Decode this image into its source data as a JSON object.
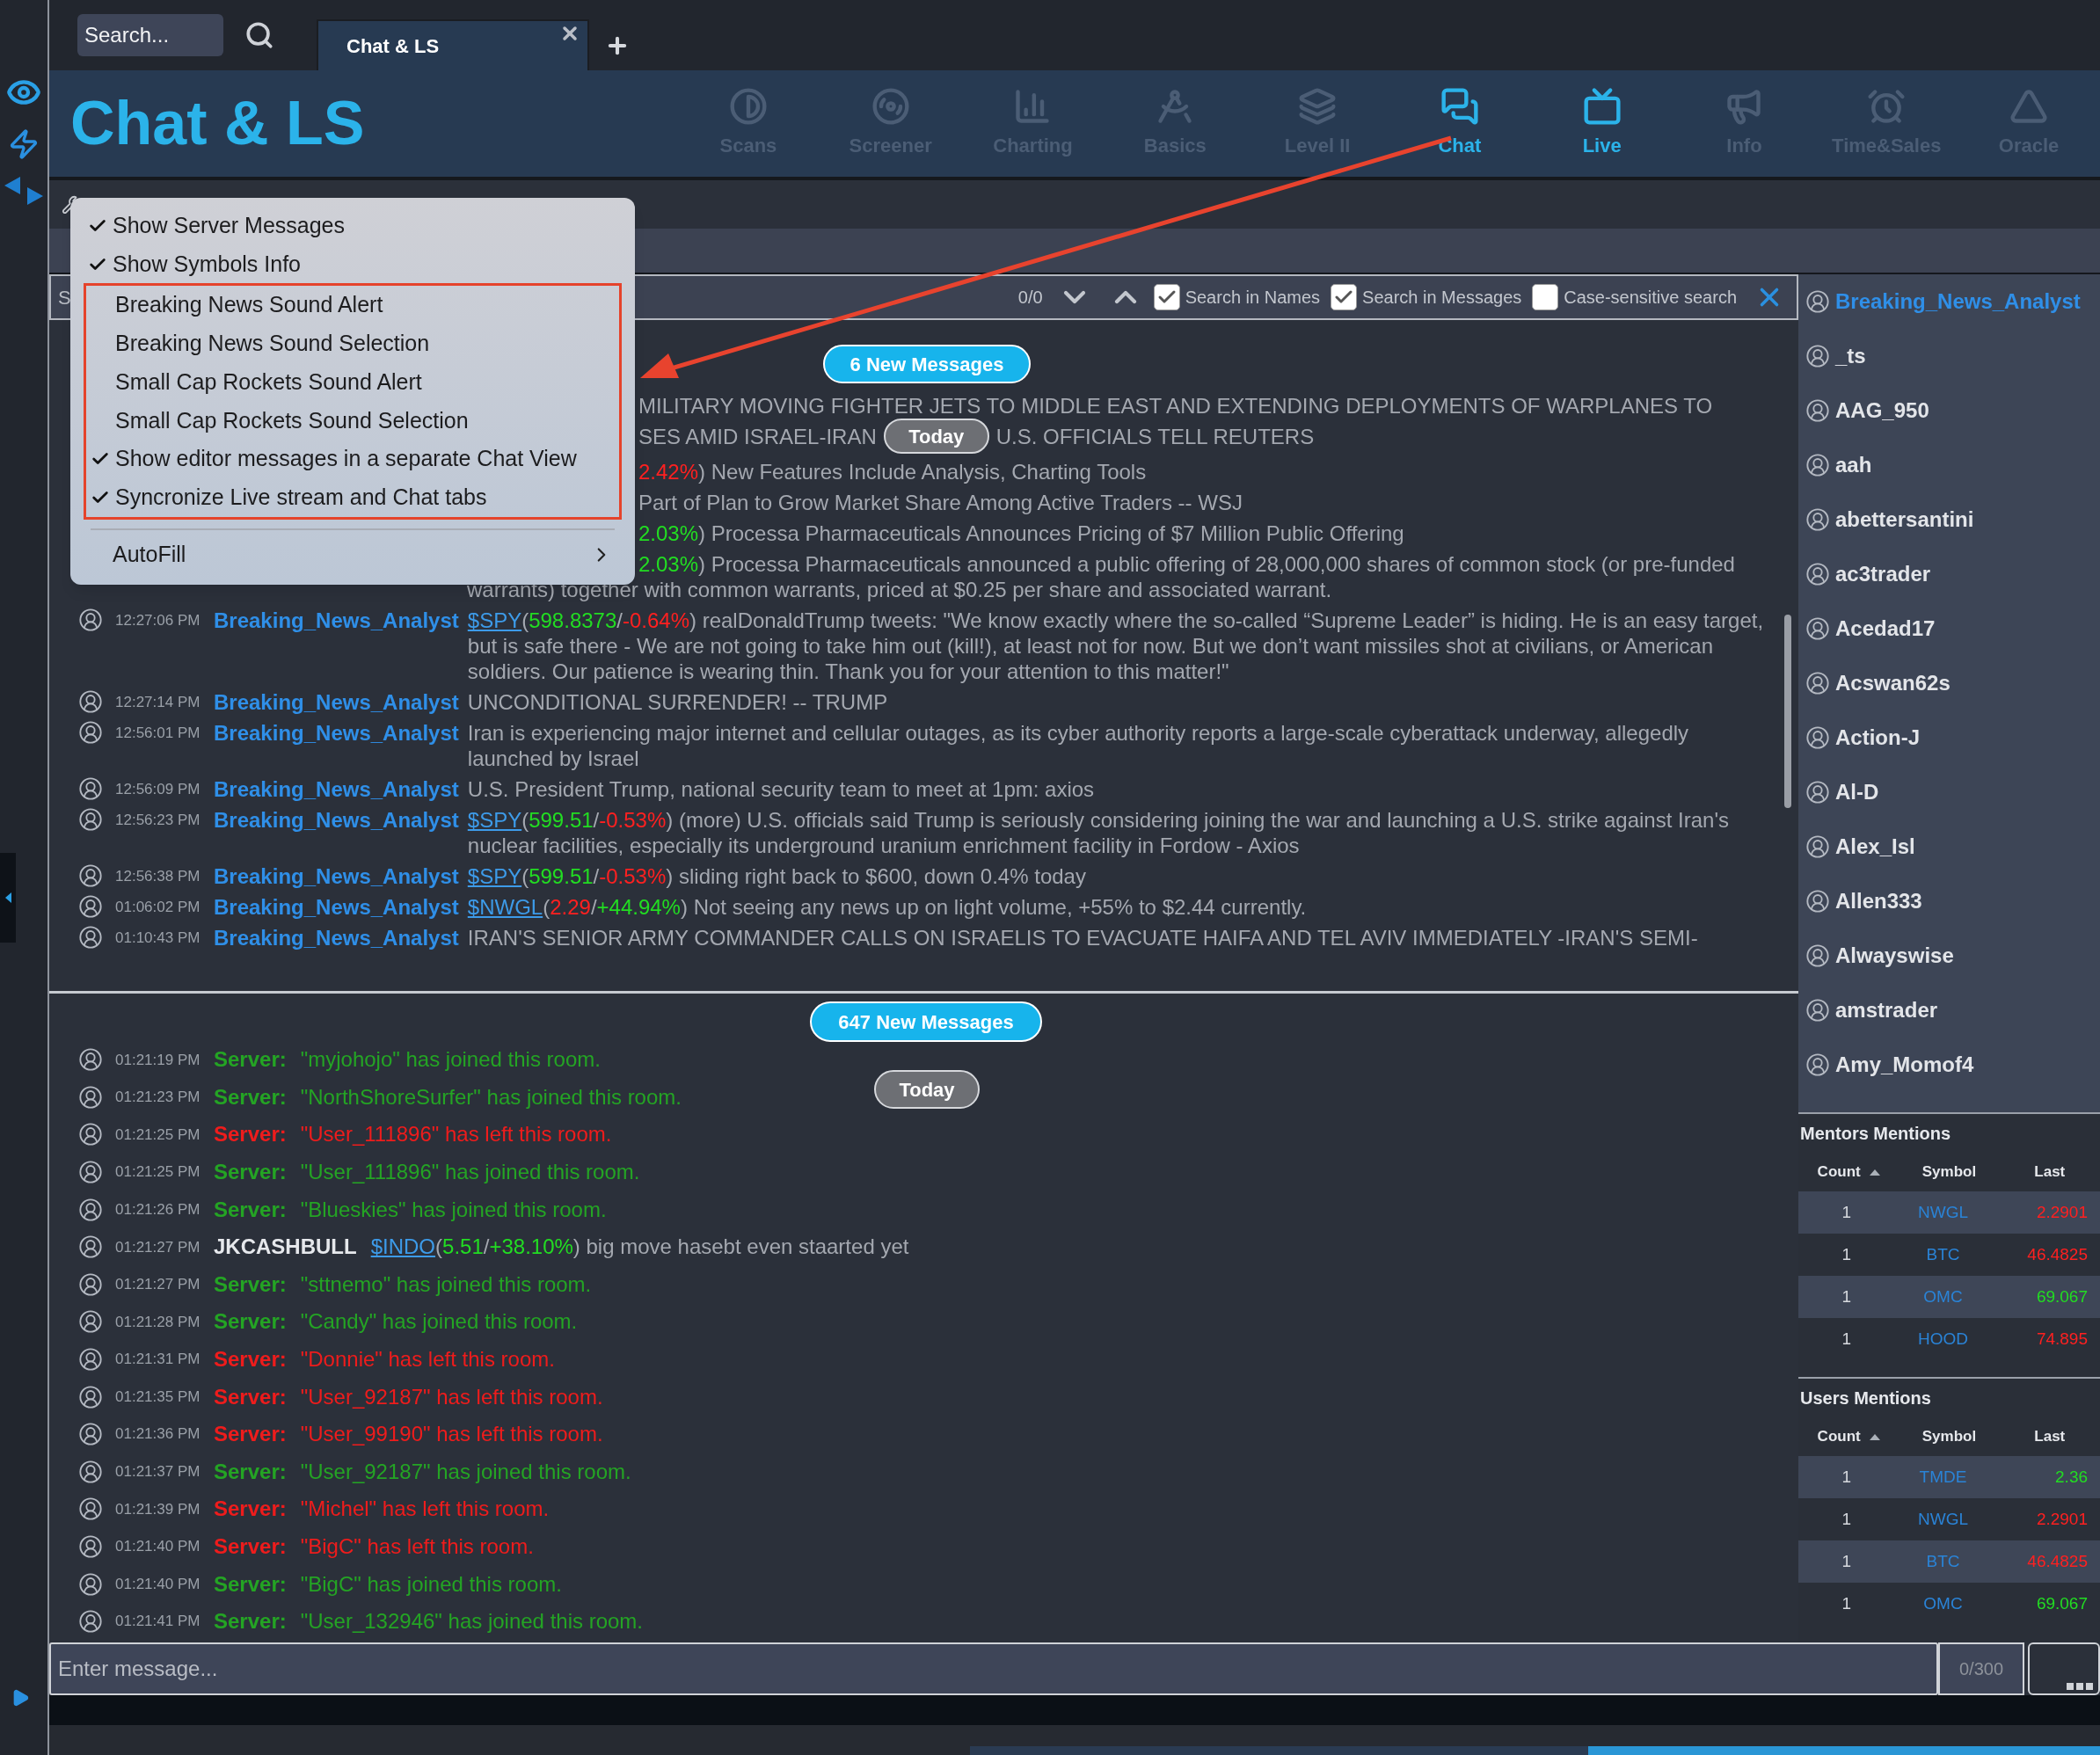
{
  "top_bar": {
    "search_placeholder": "Search...",
    "tabs": [
      {
        "label": "Chat & LS",
        "selected": true
      }
    ]
  },
  "header": {
    "title": "Chat & LS",
    "nav": [
      {
        "label": "Scans",
        "active": false
      },
      {
        "label": "Screener",
        "active": false
      },
      {
        "label": "Charting",
        "active": false
      },
      {
        "label": "Basics",
        "active": false
      },
      {
        "label": "Level II",
        "active": false
      },
      {
        "label": "Chat",
        "active": true
      },
      {
        "label": "Live",
        "active": true
      },
      {
        "label": "Info",
        "active": false
      },
      {
        "label": "Time&Sales",
        "active": false
      },
      {
        "label": "Oracle",
        "active": false
      }
    ]
  },
  "menu": {
    "items": [
      {
        "label": "Show Server Messages",
        "checked": true,
        "highlighted": false
      },
      {
        "label": "Show Symbols Info",
        "checked": true,
        "highlighted": false
      },
      {
        "label": "Breaking News Sound Alert",
        "checked": false,
        "highlighted": true
      },
      {
        "label": "Breaking News Sound Selection",
        "checked": false,
        "highlighted": true
      },
      {
        "label": "Small Cap Rockets Sound Alert",
        "checked": false,
        "highlighted": true
      },
      {
        "label": "Small Cap Rockets Sound Selection",
        "checked": false,
        "highlighted": true
      },
      {
        "label": "Show editor messages in a separate Chat View",
        "checked": true,
        "highlighted": true
      },
      {
        "label": "Syncronize Live stream and Chat tabs",
        "checked": true,
        "highlighted": true
      }
    ],
    "submenu": {
      "label": "AutoFill"
    }
  },
  "search_bar": {
    "placeholder": "S",
    "count": "0/0",
    "options": [
      {
        "label": "Search in Names",
        "checked": true
      },
      {
        "label": "Search in Messages",
        "checked": true
      },
      {
        "label": "Case-sensitive search",
        "checked": false
      }
    ]
  },
  "editor_pane": {
    "new_messages": "6 New Messages",
    "day_label": "Today",
    "messages": [
      {
        "kind": "fragment",
        "text": "MILITARY MOVING FIGHTER JETS TO MIDDLE EAST AND EXTENDING DEPLOYMENTS OF WARPLANES TO",
        "line_2_parts": [
          "SES AMID ISRAEL-IRAN",
          "U.S. OFFICIALS TELL REUTERS"
        ]
      },
      {
        "kind": "fragment",
        "change": "2.42%",
        "change_up": false,
        "text": ") New Features Include Analysis, Charting Tools"
      },
      {
        "kind": "fragment",
        "text": "Part of Plan to Grow Market Share Among Active Traders -- WSJ"
      },
      {
        "kind": "fragment",
        "change": "2.03%",
        "change_up": true,
        "text": ") Processa Pharmaceuticals Announces Pricing of $7 Million Public Offering"
      },
      {
        "kind": "fragment",
        "change": "2.03%",
        "change_up": true,
        "text": ") Processa Pharmaceuticals announced a public offering of 28,000,000 shares of common stock (or pre-funded",
        "continuation": "warrants) together with common warrants, priced at $0.25 per share and associated warrant."
      },
      {
        "kind": "message",
        "time": "12:27:06 PM",
        "user": "Breaking_News_Analyst",
        "quote": {
          "symbol": "$SPY",
          "open": "(",
          "price": "598.8373",
          "price_up": true,
          "separator": "/",
          "change": "-0.64%",
          "change_up": false,
          "close": ")"
        },
        "text": "realDonaldTrump tweets: \"We know exactly where the so-called “Supreme Leader” is hiding. He is an easy target, but is safe there - We are not going to take him out (kill!), at least not for now. But we don’t want missiles shot at civilians, or American soldiers. Our patience is wearing thin. Thank you for your attention to this matter!\""
      },
      {
        "kind": "message",
        "time": "12:27:14 PM",
        "user": "Breaking_News_Analyst",
        "text": "UNCONDITIONAL SURRENDER! -- TRUMP"
      },
      {
        "kind": "message",
        "time": "12:56:01 PM",
        "user": "Breaking_News_Analyst",
        "text": "Iran is experiencing major internet and cellular outages, as its cyber authority reports a large-scale cyberattack underway, allegedly launched by Israel"
      },
      {
        "kind": "message",
        "time": "12:56:09 PM",
        "user": "Breaking_News_Analyst",
        "text": "U.S. President Trump, national security team to meet at 1pm: axios"
      },
      {
        "kind": "message",
        "time": "12:56:23 PM",
        "user": "Breaking_News_Analyst",
        "quote": {
          "symbol": "$SPY",
          "open": "(",
          "price": "599.51",
          "price_up": true,
          "separator": "/",
          "change": "-0.53%",
          "change_up": false,
          "close": ")"
        },
        "text": "(more) U.S. officials said Trump is seriously considering joining the war and launching a U.S. strike against Iran's nuclear facilities, especially its underground uranium enrichment facility in Fordow - Axios"
      },
      {
        "kind": "message",
        "time": "12:56:38 PM",
        "user": "Breaking_News_Analyst",
        "quote": {
          "symbol": "$SPY",
          "open": "(",
          "price": "599.51",
          "price_up": true,
          "separator": "/",
          "change": "-0.53%",
          "change_up": false,
          "close": ")"
        },
        "text": "sliding right back to $600, down 0.4% today"
      },
      {
        "kind": "message",
        "time": "01:06:02 PM",
        "user": "Breaking_News_Analyst",
        "quote": {
          "symbol": "$NWGL",
          "open": "(",
          "price": "2.29",
          "price_up": false,
          "separator": "/",
          "change": "+44.94%",
          "change_up": true,
          "close": ")"
        },
        "text": "Not seeing any news up on light volume, +55% to $2.44 currently."
      },
      {
        "kind": "message",
        "time": "01:10:43 PM",
        "user": "Breaking_News_Analyst",
        "text": "IRAN'S SENIOR ARMY COMMANDER CALLS ON ISRAELIS TO EVACUATE HAIFA AND TEL AVIV IMMEDIATELY -IRAN'S SEMI-"
      }
    ]
  },
  "main_pane": {
    "new_messages": "647 New Messages",
    "day_label": "Today",
    "messages": [
      {
        "kind": "server",
        "time": "01:21:19 PM",
        "sender": "Server:",
        "text": "\"myjohojo\" has joined this room.",
        "joined": true
      },
      {
        "kind": "server",
        "time": "01:21:23 PM",
        "sender": "Server:",
        "text": "\"NorthShoreSurfer\" has joined this room.",
        "joined": true
      },
      {
        "kind": "server",
        "time": "01:21:25 PM",
        "sender": "Server:",
        "text": "\"User_111896\" has left this room.",
        "joined": false
      },
      {
        "kind": "server",
        "time": "01:21:25 PM",
        "sender": "Server:",
        "text": "\"User_111896\" has joined this room.",
        "joined": true
      },
      {
        "kind": "server",
        "time": "01:21:26 PM",
        "sender": "Server:",
        "text": "\"Blueskies\" has joined this room.",
        "joined": true
      },
      {
        "kind": "user",
        "time": "01:21:27 PM",
        "sender": "JKCASHBULL",
        "quote": {
          "symbol": "$INDO",
          "open": "(",
          "price": "5.51",
          "price_up": true,
          "separator": "/",
          "change": "+38.10%",
          "change_up": true,
          "close": ")"
        },
        "text": "big move hasebt even staarted yet"
      },
      {
        "kind": "server",
        "time": "01:21:27 PM",
        "sender": "Server:",
        "text": "\"sttnemo\" has joined this room.",
        "joined": true
      },
      {
        "kind": "server",
        "time": "01:21:28 PM",
        "sender": "Server:",
        "text": "\"Candy\" has joined this room.",
        "joined": true
      },
      {
        "kind": "server",
        "time": "01:21:31 PM",
        "sender": "Server:",
        "text": "\"Donnie\" has left this room.",
        "joined": false
      },
      {
        "kind": "server",
        "time": "01:21:35 PM",
        "sender": "Server:",
        "text": "\"User_92187\" has left this room.",
        "joined": false
      },
      {
        "kind": "server",
        "time": "01:21:36 PM",
        "sender": "Server:",
        "text": "\"User_99190\" has left this room.",
        "joined": false
      },
      {
        "kind": "server",
        "time": "01:21:37 PM",
        "sender": "Server:",
        "text": "\"User_92187\" has joined this room.",
        "joined": true
      },
      {
        "kind": "server",
        "time": "01:21:39 PM",
        "sender": "Server:",
        "text": "\"Michel\" has left this room.",
        "joined": false
      },
      {
        "kind": "server",
        "time": "01:21:40 PM",
        "sender": "Server:",
        "text": "\"BigC\" has left this room.",
        "joined": false
      },
      {
        "kind": "server",
        "time": "01:21:40 PM",
        "sender": "Server:",
        "text": "\"BigC\" has joined this room.",
        "joined": true
      },
      {
        "kind": "server",
        "time": "01:21:41 PM",
        "sender": "Server:",
        "text": "\"User_132946\" has joined this room.",
        "joined": true
      }
    ]
  },
  "users": [
    {
      "name": "Breaking_News_Analyst",
      "selected": true
    },
    {
      "name": "_ts",
      "selected": false
    },
    {
      "name": "AAG_950",
      "selected": false
    },
    {
      "name": "aah",
      "selected": false
    },
    {
      "name": "abettersantini",
      "selected": false
    },
    {
      "name": "ac3trader",
      "selected": false
    },
    {
      "name": "Acedad17",
      "selected": false
    },
    {
      "name": "Acswan62s",
      "selected": false
    },
    {
      "name": "Action-J",
      "selected": false
    },
    {
      "name": "Al-D",
      "selected": false
    },
    {
      "name": "Alex_Isl",
      "selected": false
    },
    {
      "name": "Allen333",
      "selected": false
    },
    {
      "name": "Alwayswise",
      "selected": false
    },
    {
      "name": "amstrader",
      "selected": false
    },
    {
      "name": "Amy_Momof4",
      "selected": false
    }
  ],
  "mentors_mentions": {
    "title": "Mentors Mentions",
    "columns": [
      {
        "label": "Count",
        "sorted": true
      },
      {
        "label": "Symbol",
        "sorted": false
      },
      {
        "label": "Last",
        "sorted": false
      }
    ],
    "rows": [
      {
        "count": "1",
        "symbol": "NWGL",
        "last": "2.2901",
        "up": false
      },
      {
        "count": "1",
        "symbol": "BTC",
        "last": "46.4825",
        "up": false
      },
      {
        "count": "1",
        "symbol": "OMC",
        "last": "69.067",
        "up": true
      },
      {
        "count": "1",
        "symbol": "HOOD",
        "last": "74.895",
        "up": false
      }
    ]
  },
  "users_mentions": {
    "title": "Users Mentions",
    "columns": [
      {
        "label": "Count",
        "sorted": true
      },
      {
        "label": "Symbol",
        "sorted": false
      },
      {
        "label": "Last",
        "sorted": false
      }
    ],
    "rows": [
      {
        "count": "1",
        "symbol": "TMDE",
        "last": "2.36",
        "up": true
      },
      {
        "count": "1",
        "symbol": "NWGL",
        "last": "2.2901",
        "up": false
      },
      {
        "count": "1",
        "symbol": "BTC",
        "last": "46.4825",
        "up": false
      },
      {
        "count": "1",
        "symbol": "OMC",
        "last": "69.067",
        "up": true
      }
    ]
  },
  "composer": {
    "placeholder": "Enter message...",
    "counter": "0/300"
  }
}
